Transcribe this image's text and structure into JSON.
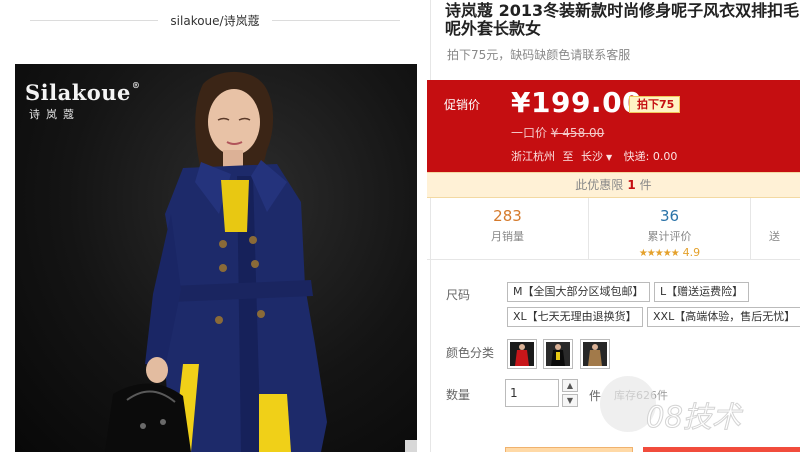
{
  "store": {
    "name": "silakoue/诗岚蔻"
  },
  "brand_logo": {
    "latin": "Silakoue",
    "registered": "®",
    "cjk": "诗岚蔻"
  },
  "product": {
    "title": "诗岚蔻 2013冬装新款时尚修身呢子风衣双排扣毛呢外套长款女",
    "subtitle": "拍下75元，缺码缺颜色请联系客服"
  },
  "price": {
    "promo_label": "促销价",
    "current": "¥199.00",
    "discount_badge": "拍下75",
    "original_prefix": "一口价",
    "original": "¥ 458.00",
    "accent_color": "#c50e11"
  },
  "shipping": {
    "origin": "浙江杭州",
    "to_label": "至",
    "destination": "长沙",
    "express": "快递: 0.00"
  },
  "limit": {
    "prefix": "此优惠限",
    "count": "1",
    "suffix": "件"
  },
  "stats": [
    {
      "value": "283",
      "label": "月销量"
    },
    {
      "value": "36",
      "label": "累计评价",
      "stars": "★★★★★",
      "score": "4.9"
    },
    {
      "value": "",
      "label": "送"
    }
  ],
  "options": {
    "size_label": "尺码",
    "sizes": [
      "M【全国大部分区域包邮】",
      "L【赠送运费险】",
      "XL【七天无理由退换货】",
      "XXL【高端体验，售后无忧】"
    ],
    "color_label": "颜色分类",
    "colors": [
      "red",
      "black",
      "brown"
    ]
  },
  "quantity": {
    "label": "数量",
    "value": "1",
    "unit": "件",
    "stock": "库存626件"
  },
  "watermark": {
    "text": "08技术"
  }
}
